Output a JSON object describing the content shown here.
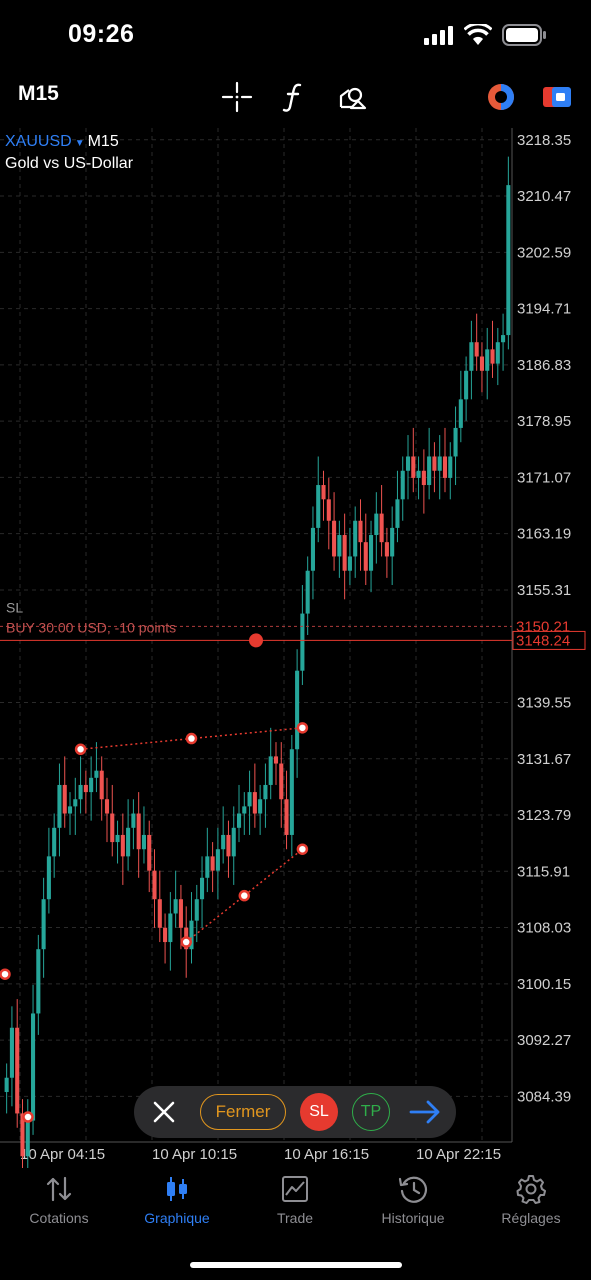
{
  "status_bar": {
    "time": "09:26"
  },
  "toolbar": {
    "timeframe": "M15",
    "icons": [
      "crosshair-icon",
      "function-icon",
      "objects-icon",
      "one-click-trading-icon",
      "account-icon"
    ]
  },
  "symbol": {
    "name": "XAUUSD",
    "timeframe": "M15",
    "description": "Gold vs US-Dollar"
  },
  "colors": {
    "bull": "#26a69a",
    "bear": "#ef5350",
    "accent": "#2f7ff5",
    "grid": "#2a2a2a"
  },
  "chart_data": {
    "type": "candlestick",
    "ylim": [
      3078,
      3220
    ],
    "y_ticks": [
      "3218.35",
      "3210.47",
      "3202.59",
      "3194.71",
      "3186.83",
      "3178.95",
      "3171.07",
      "3163.19",
      "3155.31",
      "3139.55",
      "3131.67",
      "3123.79",
      "3115.91",
      "3108.03",
      "3100.15",
      "3092.27",
      "3084.39"
    ],
    "x_ticks": [
      "10 Apr 04:15",
      "10 Apr 10:15",
      "10 Apr 16:15",
      "10 Apr 22:15"
    ],
    "closes": [
      3087,
      3094,
      3082,
      3076,
      3081,
      3096,
      3105,
      3112,
      3118,
      3122,
      3128,
      3124,
      3125,
      3126,
      3128,
      3127,
      3129,
      3130,
      3126,
      3124,
      3120,
      3121,
      3118,
      3122,
      3124,
      3119,
      3121,
      3116,
      3112,
      3108,
      3106,
      3110,
      3112,
      3108,
      3105,
      3109,
      3112,
      3115,
      3118,
      3116,
      3119,
      3121,
      3118,
      3122,
      3124,
      3125,
      3127,
      3124,
      3126,
      3128,
      3132,
      3131,
      3126,
      3121,
      3133,
      3144,
      3152,
      3158,
      3164,
      3170,
      3168,
      3165,
      3160,
      3163,
      3158,
      3160,
      3165,
      3162,
      3158,
      3163,
      3166,
      3162,
      3160,
      3164,
      3168,
      3172,
      3174,
      3171,
      3172,
      3170,
      3174,
      3172,
      3174,
      3171,
      3174,
      3178,
      3182,
      3186,
      3190,
      3188,
      3186,
      3189,
      3187,
      3190,
      3191,
      3212
    ],
    "series_lines": [
      {
        "name": "pending-line",
        "value": 3150.21,
        "label": "3150.21"
      },
      {
        "name": "buy-line",
        "value": 3148.24,
        "label": "3148.24"
      }
    ],
    "order_label": "BUY 30.00 USD, -10 points",
    "sl_label": "SL",
    "trend_lines": [
      {
        "from": [
          14,
          3133
        ],
        "to": [
          56,
          3136
        ]
      },
      {
        "from": [
          34,
          3106
        ],
        "to": [
          56,
          3119
        ]
      }
    ]
  },
  "overlay": {
    "close": "×",
    "fermer": "Fermer",
    "sl": "SL",
    "tp": "TP"
  },
  "tabs": [
    {
      "name": "tab-cotations",
      "label": "Cotations",
      "icon": "arrows-updown-icon",
      "active": false
    },
    {
      "name": "tab-graphique",
      "label": "Graphique",
      "icon": "candlestick-icon",
      "active": true
    },
    {
      "name": "tab-trade",
      "label": "Trade",
      "icon": "trade-chart-icon",
      "active": false
    },
    {
      "name": "tab-historique",
      "label": "Historique",
      "icon": "history-clock-icon",
      "active": false
    },
    {
      "name": "tab-reglages",
      "label": "Réglages",
      "icon": "gear-icon",
      "active": false
    }
  ]
}
